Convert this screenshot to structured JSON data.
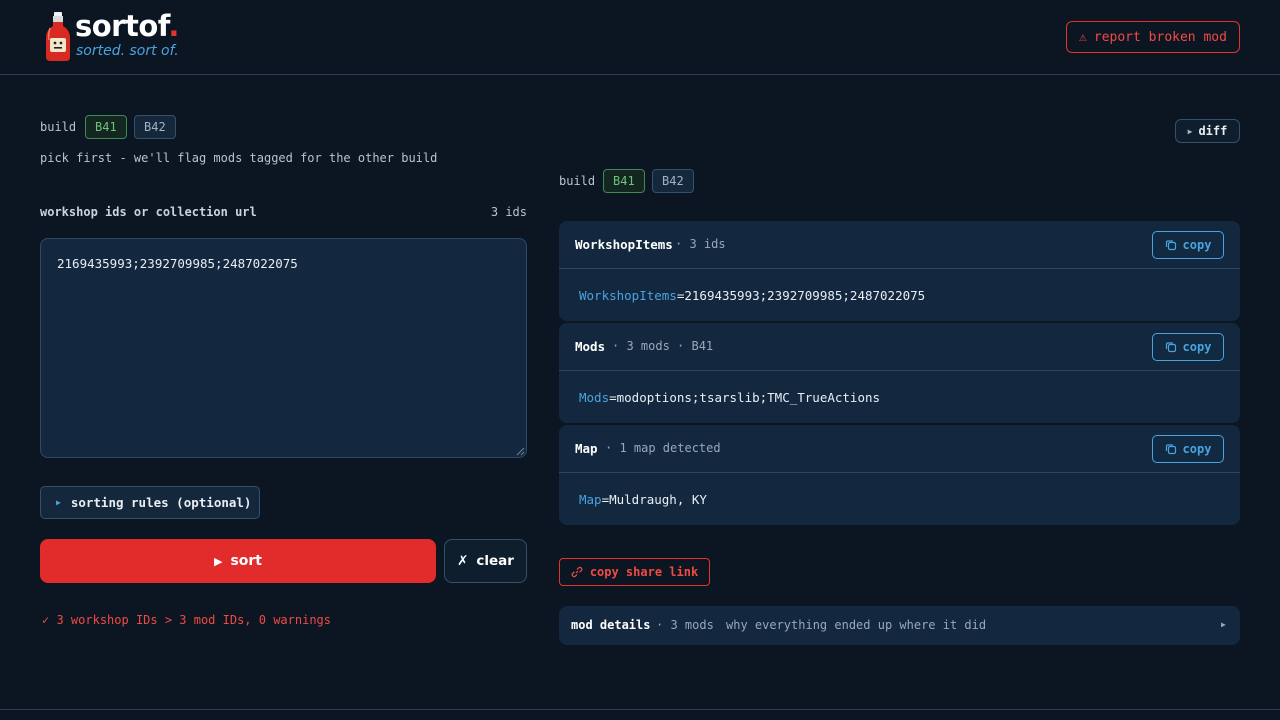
{
  "brand": {
    "name": "sortof",
    "dot": ".",
    "tagline": "sorted. sort of."
  },
  "header": {
    "report_label": "report broken mod",
    "report_icon": "⚠"
  },
  "left": {
    "build_label": "build",
    "builds": [
      "B41",
      "B42"
    ],
    "selected_build": "B41",
    "hint": "pick first - we'll flag mods tagged for the other build",
    "ids_label": "workshop ids or collection url",
    "ids_count": "3 ids",
    "ids_value": "2169435993;2392709985;2487022075",
    "rules_label": "sorting rules (optional)",
    "sort_label": "sort",
    "sort_icon": "▶",
    "clear_label": "clear",
    "clear_icon": "✗",
    "status_check": "✓",
    "status_text": "3 workshop IDs > 3 mod IDs, 0 warnings"
  },
  "right": {
    "diff_label": "diff",
    "build_label": "build",
    "builds": [
      "B41",
      "B42"
    ],
    "selected_build": "B41",
    "cards": [
      {
        "title": "WorkshopItems",
        "meta": "· 3 ids",
        "copy_label": "copy",
        "key": "WorkshopItems",
        "value": "=2169435993;2392709985;2487022075"
      },
      {
        "title": "Mods",
        "meta": "· 3 mods · B41",
        "copy_label": "copy",
        "key": "Mods",
        "value": "=modoptions;tsarslib;TMC_TrueActions"
      },
      {
        "title": "Map",
        "meta": "· 1 map detected",
        "copy_label": "copy",
        "key": "Map",
        "value": "=Muldraugh, KY"
      }
    ],
    "share_label": "copy share link",
    "details": {
      "title": "mod details",
      "meta": "· 3 mods",
      "desc": "why everything ended up where it did"
    }
  },
  "colors": {
    "background": "#0b1622",
    "accent_red": "#e22b2b",
    "accent_blue": "#4aa3df",
    "accent_green": "#6cc37f",
    "card": "#13283e"
  }
}
